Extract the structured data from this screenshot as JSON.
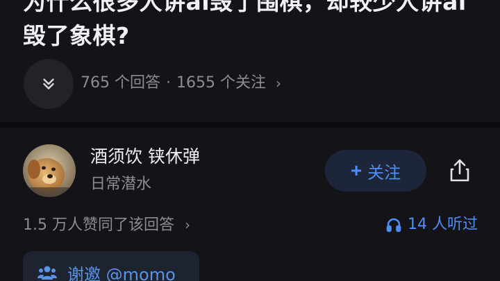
{
  "question": {
    "title": "为什么很多人讲ai毁了围棋，却较少人讲ai毁了象棋?",
    "answers_count": "765 个回答",
    "separator": "·",
    "followers_count": "1655 个关注",
    "meta_chevron": "›"
  },
  "icons": {
    "expand": "chevron-double-down-icon",
    "share": "share-icon",
    "headphones": "headphones-icon",
    "invite": "people-icon"
  },
  "author": {
    "name": "酒须饮 铗休弹",
    "bio": "日常潜水",
    "follow_plus": "+",
    "follow_label": "关注"
  },
  "answer": {
    "upvote_text": "1.5 万人赞同了该回答",
    "upvote_chevron": "›",
    "listen_text": "14 人听过"
  },
  "invite": {
    "label": "谢邀 @momo"
  },
  "colors": {
    "background": "#131318",
    "accent": "#4f8ef7",
    "secondary_text": "#8c8c93"
  }
}
